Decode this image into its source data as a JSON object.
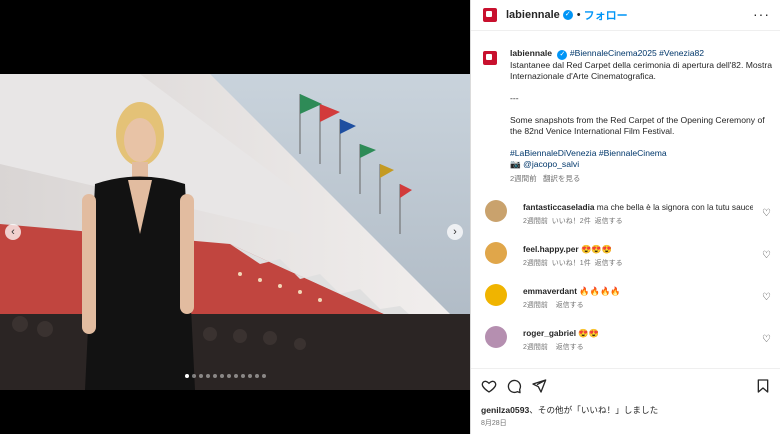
{
  "account": {
    "username": "labiennale",
    "follow_label": "フォロー"
  },
  "caption": {
    "hashtags_top": "#BiennaleCinema2025 #Venezia82",
    "italian": "Istantanee dal Red Carpet della cerimonia di apertura dell'82. Mostra Internazionale d'Arte Cinematografica.",
    "divider": "---",
    "english": "Some snapshots from the Red Carpet of the Opening Ceremony of the 82nd Venice International Film Festival.",
    "hashtags_bottom": "#LaBiennaleDiVenezia #BiennaleCinema",
    "credit": "@jacopo_salvi",
    "time": "2週間前",
    "see_translation": "翻訳を見る"
  },
  "comments": [
    {
      "user": "fantasticcaseladia",
      "text": "ma che bella è la signora con la tutu sauce",
      "time": "2週間前",
      "likes": "いいね！2件",
      "reply": "返信する",
      "avatar_color": "#c9a26d"
    },
    {
      "user": "feel.happy.per",
      "text": "😍😍😍",
      "time": "2週間前",
      "likes": "いいね！1件",
      "reply": "返信する",
      "avatar_color": "#e0a64a"
    },
    {
      "user": "emmaverdant",
      "text": "🔥🔥🔥🔥",
      "time": "2週間前",
      "likes": "",
      "reply": "返信する",
      "avatar_color": "#f0b400"
    },
    {
      "user": "roger_gabriel",
      "text": "😍😍",
      "time": "2週間前",
      "likes": "",
      "reply": "返信する",
      "avatar_color": "#b58fb0"
    }
  ],
  "likes_line": {
    "user": "genilza0593",
    "rest": "、その他が「いいね！」しました"
  },
  "post_date": "8月28日",
  "carousel": {
    "prev": "‹",
    "next": "›",
    "dots": 12,
    "active_dot": 0
  }
}
